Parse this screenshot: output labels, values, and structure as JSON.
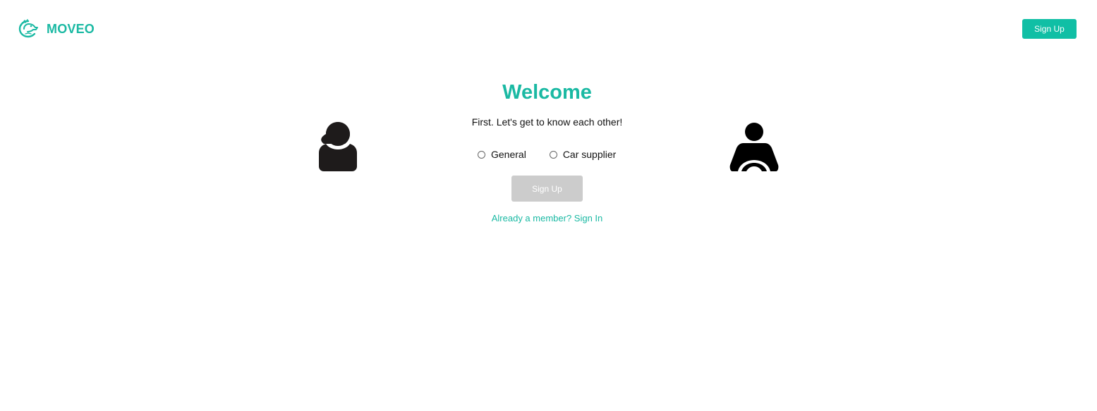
{
  "header": {
    "brand": "MOVEO",
    "signup_label": "Sign Up",
    "logo_icon": "dragon-logo-icon"
  },
  "main": {
    "title": "Welcome",
    "subtitle": "First. Let's get to know each other!",
    "options": [
      {
        "label": "General",
        "selected": false
      },
      {
        "label": "Car supplier",
        "selected": false
      }
    ],
    "signup_label": "Sign Up",
    "signin_link": "Already a member? Sign In",
    "left_icon": "person-icon",
    "right_icon": "driver-icon"
  },
  "colors": {
    "accent": "#1ab9a3",
    "button_primary": "#10bfa5",
    "button_disabled": "#cccccc",
    "text": "#111111",
    "icon": "#1e1b1b"
  }
}
